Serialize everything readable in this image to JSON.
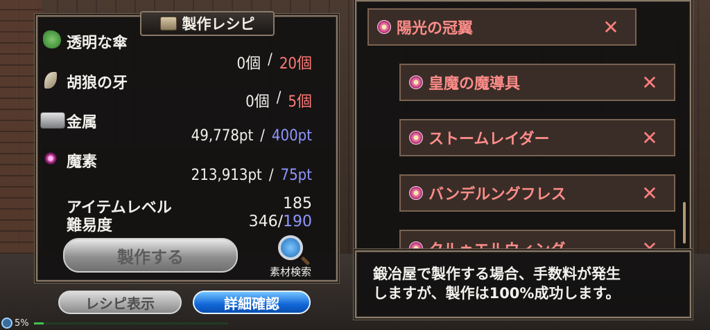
{
  "recipe_panel": {
    "title": "製作レシピ",
    "materials": [
      {
        "name": "透明な傘",
        "have": "0個",
        "sep": "/",
        "need": "20個",
        "need_color": "#ff7a78",
        "icon": "plant-icon",
        "icon_color": "#4fa84a"
      },
      {
        "name": "胡狼の牙",
        "have": "0個",
        "sep": "/",
        "need": "5個",
        "need_color": "#ff7a78",
        "icon": "fang-icon",
        "icon_color": "#d8cdb8"
      },
      {
        "name": "金属",
        "have": "49,778pt",
        "sep": "/",
        "need": "400pt",
        "need_color": "#8f96ff",
        "icon": "metal-ingot-icon",
        "icon_color": "#a8aaae"
      },
      {
        "name": "魔素",
        "have": "213,913pt",
        "sep": "/",
        "need": "75pt",
        "need_color": "#8f96ff",
        "icon": "magic-orb-icon",
        "icon_color": "#c43c9a"
      }
    ],
    "item_level_label": "アイテムレベル",
    "item_level_value": "185",
    "difficulty_label": "難易度",
    "difficulty_current": "346/",
    "difficulty_max": "190",
    "craft_button": "製作する",
    "search_label": "素材検索"
  },
  "bottom_buttons": {
    "show_recipe": "レシピ表示",
    "details": "詳細確認"
  },
  "recipe_list": {
    "items": [
      {
        "label": "陽光の冠翼",
        "remove": "✕"
      },
      {
        "label": "皇魔の魔導具",
        "remove": "✕"
      },
      {
        "label": "ストームレイダー",
        "remove": "✕"
      },
      {
        "label": "バンデルングフレス",
        "remove": "✕"
      },
      {
        "label": "クルゥエルウィング",
        "remove": "✕"
      }
    ]
  },
  "message": {
    "text": "鍛冶屋で製作する場合、手数料が発生\nしますが、製作は100%成功します。"
  },
  "status": {
    "percent": "5%",
    "progress": 0.05
  }
}
